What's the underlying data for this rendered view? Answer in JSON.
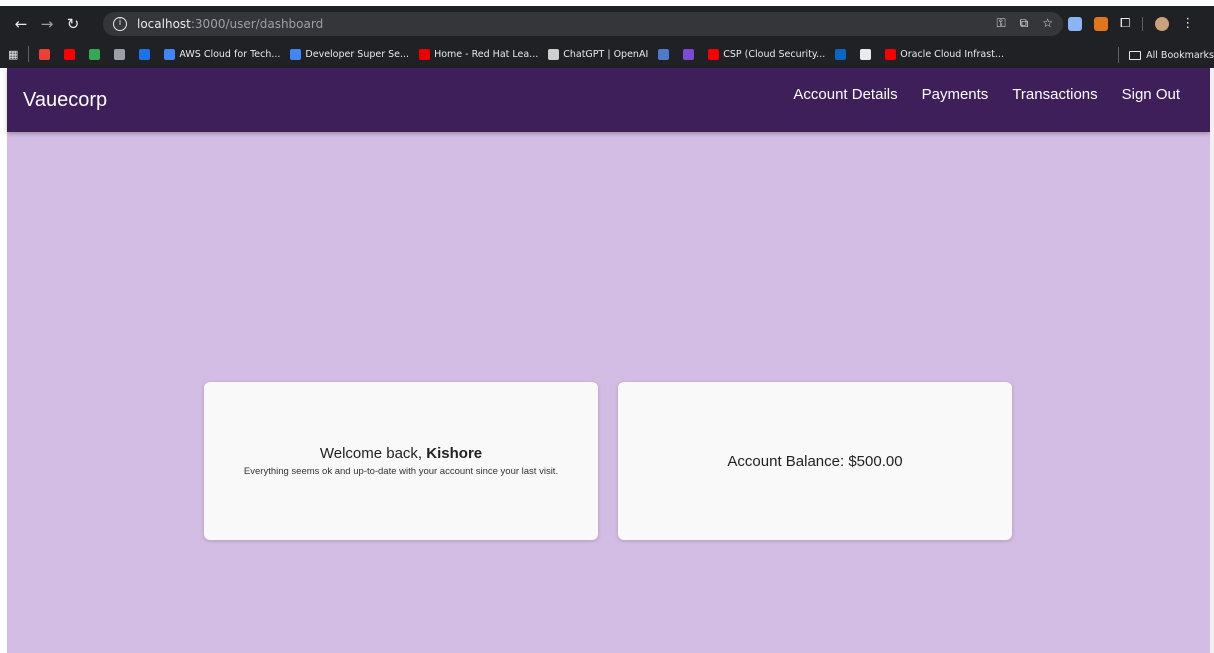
{
  "browser": {
    "url_host": "localhost",
    "url_path": ":3000/user/dashboard",
    "bookmarks": [
      {
        "label": "",
        "color": "#ea4335"
      },
      {
        "label": "",
        "color": "#ff0000"
      },
      {
        "label": "",
        "color": "#34a853"
      },
      {
        "label": "",
        "color": "#9aa0a6"
      },
      {
        "label": "",
        "color": "#1a73e8"
      },
      {
        "label": "AWS Cloud for Tech...",
        "color": "#4285f4"
      },
      {
        "label": "Developer Super Se...",
        "color": "#4285f4"
      },
      {
        "label": "Home - Red Hat Lea...",
        "color": "#ee0000"
      },
      {
        "label": "ChatGPT | OpenAI",
        "color": "#cfcfcf"
      },
      {
        "label": "",
        "color": "#4f7ac9"
      },
      {
        "label": "",
        "color": "#7b4bd6"
      },
      {
        "label": "CSP (Cloud Security...",
        "color": "#f80000"
      },
      {
        "label": "",
        "color": "#0a66c2"
      },
      {
        "label": "",
        "color": "#e8eaed"
      },
      {
        "label": "Oracle Cloud Infrast...",
        "color": "#f80000"
      }
    ],
    "all_bookmarks": "All Bookmarks"
  },
  "app": {
    "brand": "Vauecorp",
    "nav": {
      "account_details": "Account Details",
      "payments": "Payments",
      "transactions": "Transactions",
      "sign_out": "Sign Out"
    },
    "welcome": {
      "prefix": "Welcome back, ",
      "name": "Kishore",
      "message": "Everything seems ok and up-to-date with your account since your last visit."
    },
    "balance": {
      "text": "Account Balance: $500.00"
    }
  },
  "colors": {
    "appbar": "#3e1f5a",
    "background": "#d4bde4",
    "card": "#f9f9f9"
  }
}
